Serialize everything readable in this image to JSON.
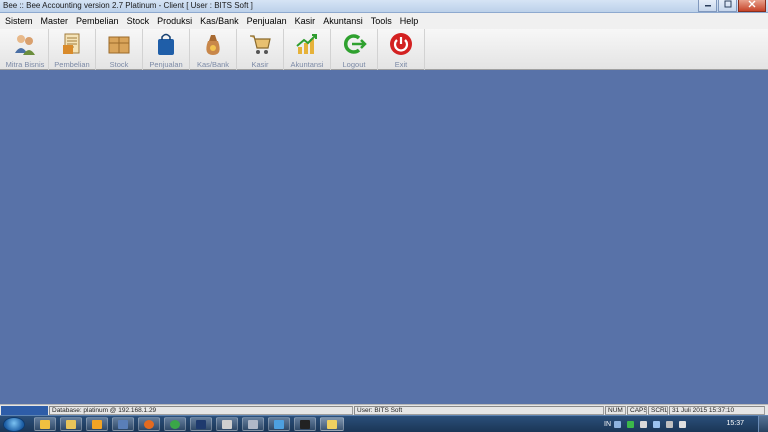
{
  "window": {
    "title": "Bee :: Bee Accounting version 2.7 Platinum - Client  [ User : BITS Soft ]",
    "controls": [
      "minimize",
      "maximize",
      "close"
    ]
  },
  "menu": [
    "Sistem",
    "Master",
    "Pembelian",
    "Stock",
    "Produksi",
    "Kas/Bank",
    "Penjualan",
    "Kasir",
    "Akuntansi",
    "Tools",
    "Help"
  ],
  "toolbar": [
    {
      "label": "Mitra Bisnis",
      "icon": "partners-icon"
    },
    {
      "label": "Pembelian",
      "icon": "purchase-icon"
    },
    {
      "label": "Stock",
      "icon": "stock-box-icon"
    },
    {
      "label": "Penjualan",
      "icon": "shopping-bag-icon"
    },
    {
      "label": "Kas/Bank",
      "icon": "money-bag-icon"
    },
    {
      "label": "Kasir",
      "icon": "cashier-cart-icon"
    },
    {
      "label": "Akuntansi",
      "icon": "chart-up-icon"
    },
    {
      "label": "Logout",
      "icon": "logout-icon"
    },
    {
      "label": "Exit",
      "icon": "power-icon"
    }
  ],
  "statusbar": {
    "database": "Database: platinum @ 192.168.1.29",
    "user": "User: BITS Soft",
    "num": "NUM",
    "caps": "CAPS",
    "scrl": "SCRL",
    "datetime": "31 Juli 2015  15:37:10"
  },
  "taskbar": {
    "language": "IN",
    "clock": "15:37",
    "apps": [
      "explorer",
      "media-player",
      "app-b",
      "firefox",
      "chrome",
      "photoshop",
      "app-c",
      "app-d",
      "app-e",
      "console",
      "bee-accounting"
    ]
  },
  "colors": {
    "workspace": "#5872a8",
    "taskbar": "#1f3d62",
    "exit_red": "#d32121",
    "logout_green": "#2fa12f"
  }
}
